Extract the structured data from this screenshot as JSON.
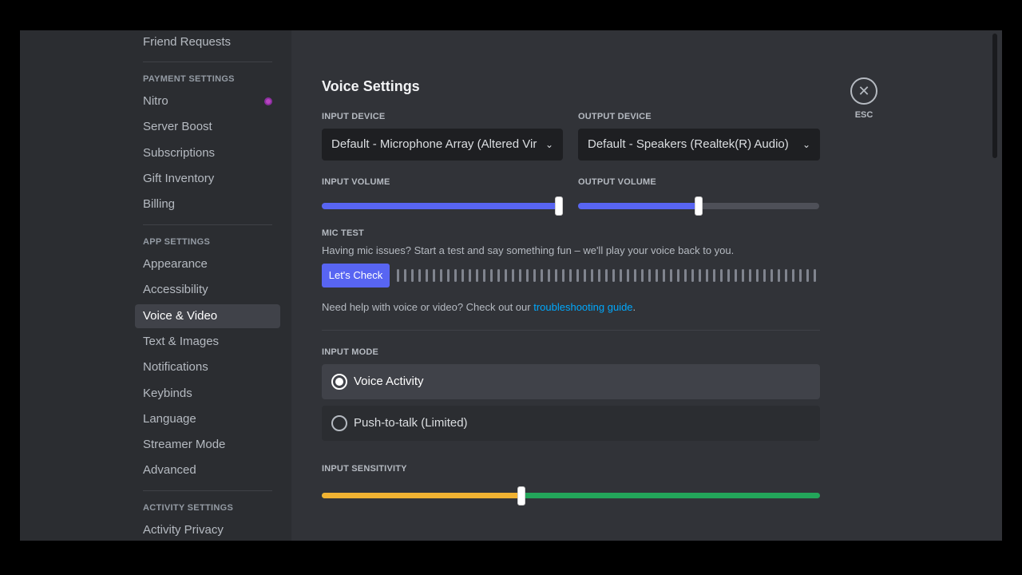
{
  "sidebar": {
    "friend_requests": "Friend Requests",
    "payment_header": "PAYMENT SETTINGS",
    "payment_items": [
      "Nitro",
      "Server Boost",
      "Subscriptions",
      "Gift Inventory",
      "Billing"
    ],
    "app_header": "APP SETTINGS",
    "app_items": [
      "Appearance",
      "Accessibility",
      "Voice & Video",
      "Text & Images",
      "Notifications",
      "Keybinds",
      "Language",
      "Streamer Mode",
      "Advanced"
    ],
    "active_item": "Voice & Video",
    "activity_header": "ACTIVITY SETTINGS",
    "activity_items": [
      "Activity Privacy"
    ]
  },
  "main": {
    "title": "Voice Settings",
    "input_device_label": "INPUT DEVICE",
    "input_device_value": "Default - Microphone Array (Altered Vir",
    "output_device_label": "OUTPUT DEVICE",
    "output_device_value": "Default - Speakers (Realtek(R) Audio)",
    "input_volume_label": "INPUT VOLUME",
    "input_volume_percent": 100,
    "output_volume_label": "OUTPUT VOLUME",
    "output_volume_percent": 50,
    "mic_test_label": "MIC TEST",
    "mic_test_desc": "Having mic issues? Start a test and say something fun – we'll play your voice back to you.",
    "lets_check": "Let's Check",
    "help_text": "Need help with voice or video? Check out our ",
    "help_link": "troubleshooting guide",
    "help_end": ".",
    "input_mode_label": "INPUT MODE",
    "modes": [
      "Voice Activity",
      "Push-to-talk (Limited)"
    ],
    "selected_mode": "Voice Activity",
    "sensitivity_label": "INPUT SENSITIVITY",
    "sensitivity_percent": 40
  },
  "esc": {
    "label": "ESC",
    "icon": "close-icon"
  },
  "colors": {
    "accent": "#5865f2",
    "link": "#00a8fc",
    "sens_low": "#f0b232",
    "sens_high": "#23a55a"
  }
}
